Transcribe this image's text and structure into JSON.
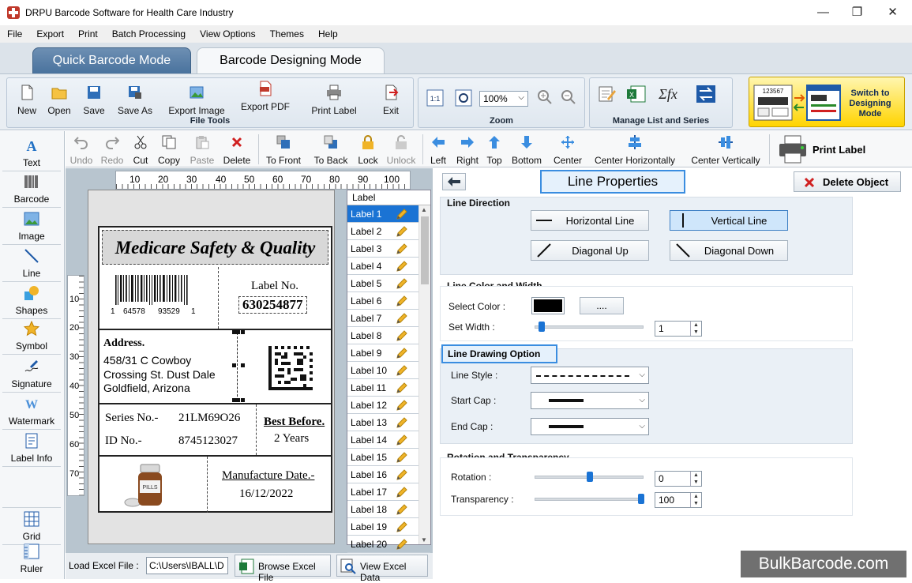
{
  "window": {
    "title": "DRPU Barcode Software for Health Care Industry"
  },
  "menu": [
    "File",
    "Export",
    "Print",
    "Batch Processing",
    "View Options",
    "Themes",
    "Help"
  ],
  "mode_tabs": {
    "quick": "Quick Barcode Mode",
    "design": "Barcode Designing Mode"
  },
  "file_tools": {
    "title": "File Tools",
    "buttons": [
      "New",
      "Open",
      "Save",
      "Save As",
      "Export Image",
      "Export PDF",
      "Print Label",
      "Exit"
    ]
  },
  "zoom": {
    "title": "Zoom",
    "value": "100%"
  },
  "manage": {
    "title": "Manage List and Series"
  },
  "switch_button": {
    "label": "Switch to Designing Mode",
    "line1": "Switch to",
    "line2": "Designing",
    "line3": "Mode",
    "icon_text": "123567"
  },
  "left_tools": [
    "Text",
    "Barcode",
    "Image",
    "Line",
    "Shapes",
    "Symbol",
    "Signature",
    "Watermark",
    "Label Info",
    "Grid",
    "Ruler"
  ],
  "edit_toolbar": {
    "buttons": [
      "Undo",
      "Redo",
      "Cut",
      "Copy",
      "Paste",
      "Delete",
      "To Front",
      "To Back",
      "Lock",
      "Unlock",
      "Left",
      "Right",
      "Top",
      "Bottom",
      "Center",
      "Center Horizontally",
      "Center Vertically"
    ],
    "print_label": "Print Label"
  },
  "ruler": {
    "h_ticks": [
      "10",
      "20",
      "30",
      "40",
      "50",
      "60",
      "70",
      "80",
      "90",
      "100"
    ],
    "v_ticks": [
      "10",
      "20",
      "30",
      "40",
      "50",
      "60",
      "70"
    ]
  },
  "label_design": {
    "header": "Medicare Safety & Quality",
    "barcode_digits": [
      "1",
      "64578",
      "93529",
      "1"
    ],
    "label_no_title": "Label No.",
    "label_no_value": "630254877",
    "address_title": "Address.",
    "address_lines": [
      "458/31 C Cowboy",
      "Crossing St. Dust Dale",
      "Goldfield, Arizona"
    ],
    "series_label": "Series No.-",
    "series_value": "21LM69O26",
    "id_label": "ID No.-",
    "id_value": "8745123027",
    "best_before_title": "Best Before.",
    "best_before_value": "2 Years",
    "manufacture_title": "Manufacture Date.-",
    "manufacture_value": "16/12/2022",
    "pills_text": "PILLS"
  },
  "label_list": {
    "header": "Label",
    "items": [
      "Label 1",
      "Label 2",
      "Label 3",
      "Label 4",
      "Label 5",
      "Label 6",
      "Label 7",
      "Label 8",
      "Label 9",
      "Label 10",
      "Label 11",
      "Label 12",
      "Label 13",
      "Label 14",
      "Label 15",
      "Label 16",
      "Label 17",
      "Label 18",
      "Label 19",
      "Label 20"
    ],
    "selected_index": 0
  },
  "excel": {
    "load_label": "Load Excel File :",
    "path": "C:\\Users\\IBALL\\D",
    "browse": "Browse Excel File",
    "view": "View Excel Data"
  },
  "properties": {
    "title": "Line Properties",
    "delete": "Delete Object",
    "line_direction": {
      "title": "Line Direction",
      "options": [
        "Horizontal Line",
        "Vertical Line",
        "Diagonal Up",
        "Diagonal Down"
      ],
      "active": "Vertical Line"
    },
    "color_width": {
      "title": "Line Color and Width",
      "select_color": "Select Color :",
      "color": "#000000",
      "more": "....",
      "set_width": "Set Width :",
      "width_value": "1",
      "width_level": 0.03
    },
    "drawing": {
      "title": "Line Drawing Option",
      "style_label": "Line Style :",
      "start_cap": "Start Cap :",
      "end_cap": "End Cap :"
    },
    "rotation": {
      "title": "Rotation and Transparency",
      "rotation_label": "Rotation :",
      "rotation_value": "0",
      "transparency_label": "Transparency :",
      "transparency_value": "100",
      "rotation_level": 0.5,
      "transparency_level": 1.0
    }
  },
  "watermark": "BulkBarcode.com",
  "colors": {
    "accent": "#1a73d4",
    "ribbon": "#e9eef3",
    "tab_active": "#5a80a8",
    "switch": "#ffd400"
  }
}
